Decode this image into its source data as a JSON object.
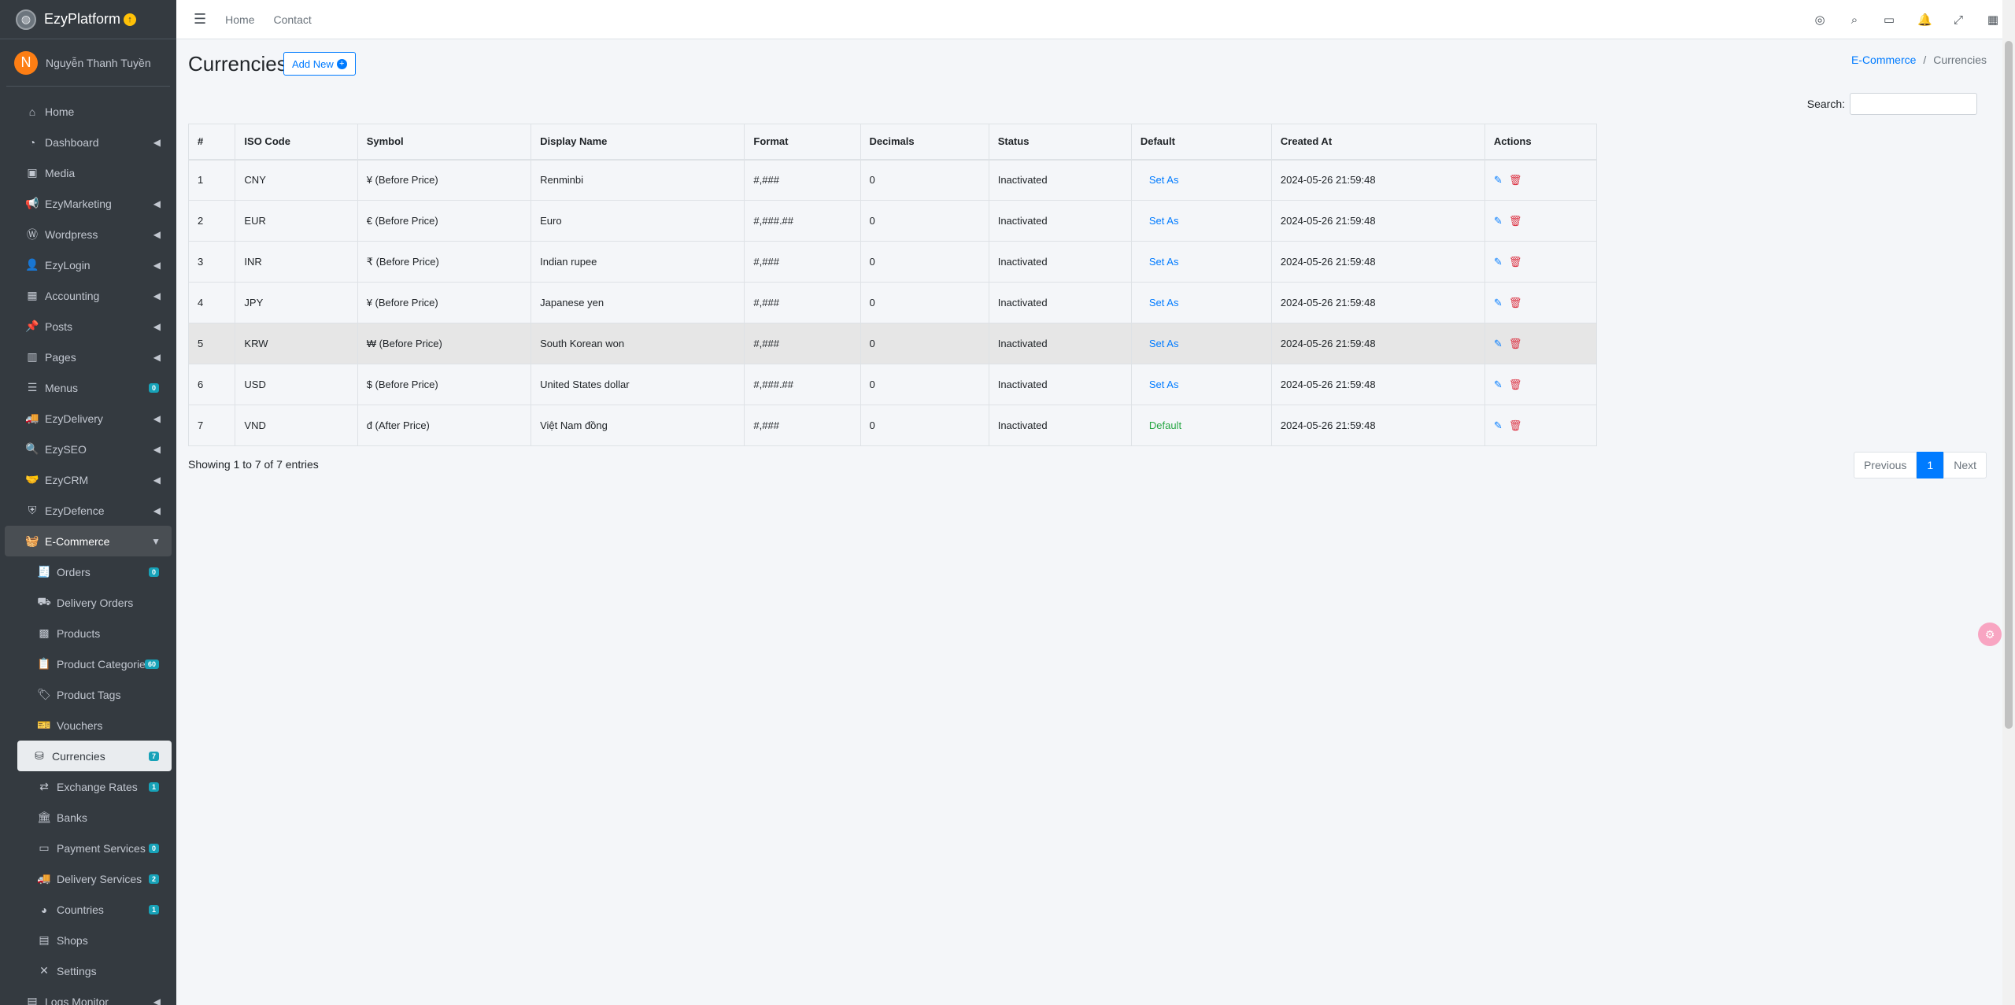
{
  "brand": {
    "name": "EzyPlatform"
  },
  "user": {
    "initial": "N",
    "name": "Nguyễn Thanh Tuyền"
  },
  "sidebar": {
    "items": [
      {
        "label": "Home",
        "icon": "home-icon",
        "arrow": false,
        "badge": null
      },
      {
        "label": "Dashboard",
        "icon": "dashboard-icon",
        "arrow": true,
        "badge": null
      },
      {
        "label": "Media",
        "icon": "image-icon",
        "arrow": false,
        "badge": null
      },
      {
        "label": "EzyMarketing",
        "icon": "megaphone-icon",
        "arrow": true,
        "badge": null
      },
      {
        "label": "Wordpress",
        "icon": "wordpress-icon",
        "arrow": true,
        "badge": null
      },
      {
        "label": "EzyLogin",
        "icon": "user-login-icon",
        "arrow": true,
        "badge": null
      },
      {
        "label": "Accounting",
        "icon": "calculator-icon",
        "arrow": true,
        "badge": null
      },
      {
        "label": "Posts",
        "icon": "pin-icon",
        "arrow": true,
        "badge": null
      },
      {
        "label": "Pages",
        "icon": "columns-icon",
        "arrow": true,
        "badge": null
      },
      {
        "label": "Menus",
        "icon": "menu-icon",
        "arrow": false,
        "badge": "0"
      },
      {
        "label": "EzyDelivery",
        "icon": "truck-icon",
        "arrow": true,
        "badge": null
      },
      {
        "label": "EzySEO",
        "icon": "seo-search-icon",
        "arrow": true,
        "badge": null
      },
      {
        "label": "EzyCRM",
        "icon": "handshake-icon",
        "arrow": true,
        "badge": null
      },
      {
        "label": "EzyDefence",
        "icon": "shield-icon",
        "arrow": true,
        "badge": null
      },
      {
        "label": "E-Commerce",
        "icon": "basket-icon",
        "arrow": true,
        "badge": null
      }
    ],
    "ecommerce_items": [
      {
        "label": "Orders",
        "icon": "receipt-icon",
        "badge": "0"
      },
      {
        "label": "Delivery Orders",
        "icon": "dolly-icon",
        "badge": null
      },
      {
        "label": "Products",
        "icon": "boxes-icon",
        "badge": null
      },
      {
        "label": "Product Categories",
        "icon": "clipboard-list-icon",
        "badge": "60"
      },
      {
        "label": "Product Tags",
        "icon": "tags-icon",
        "badge": null
      },
      {
        "label": "Vouchers",
        "icon": "ticket-icon",
        "badge": null
      },
      {
        "label": "Currencies",
        "icon": "coins-icon",
        "badge": "7"
      },
      {
        "label": "Exchange Rates",
        "icon": "exchange-icon",
        "badge": "1"
      },
      {
        "label": "Banks",
        "icon": "bank-icon",
        "badge": null
      },
      {
        "label": "Payment Services",
        "icon": "wallet-icon",
        "badge": "0"
      },
      {
        "label": "Delivery Services",
        "icon": "truck-icon",
        "badge": "2"
      },
      {
        "label": "Countries",
        "icon": "globe-icon",
        "badge": "1"
      },
      {
        "label": "Shops",
        "icon": "store-icon",
        "badge": null
      },
      {
        "label": "Settings",
        "icon": "tools-icon",
        "badge": null
      }
    ],
    "logs_monitor": "Logs Monitor"
  },
  "topbar": {
    "home": "Home",
    "contact": "Contact"
  },
  "page": {
    "title": "Currencies",
    "add_new": "Add New",
    "breadcrumb_parent": "E-Commerce",
    "breadcrumb_current": "Currencies",
    "search_label": "Search:",
    "search_value": ""
  },
  "table": {
    "columns": [
      "#",
      "ISO Code",
      "Symbol",
      "Display Name",
      "Format",
      "Decimals",
      "Status",
      "Default",
      "Created At",
      "Actions"
    ],
    "rows": [
      {
        "num": "1",
        "iso": "CNY",
        "symbol": "¥ (Before Price)",
        "display": "Renminbi",
        "format": "#,###",
        "decimals": "0",
        "status": "Inactivated",
        "default": "Set As",
        "created": "2024-05-26 21:59:48"
      },
      {
        "num": "2",
        "iso": "EUR",
        "symbol": "€ (Before Price)",
        "display": "Euro",
        "format": "#,###.##",
        "decimals": "0",
        "status": "Inactivated",
        "default": "Set As",
        "created": "2024-05-26 21:59:48"
      },
      {
        "num": "3",
        "iso": "INR",
        "symbol": "₹ (Before Price)",
        "display": "Indian rupee",
        "format": "#,###",
        "decimals": "0",
        "status": "Inactivated",
        "default": "Set As",
        "created": "2024-05-26 21:59:48"
      },
      {
        "num": "4",
        "iso": "JPY",
        "symbol": "¥ (Before Price)",
        "display": "Japanese yen",
        "format": "#,###",
        "decimals": "0",
        "status": "Inactivated",
        "default": "Set As",
        "created": "2024-05-26 21:59:48"
      },
      {
        "num": "5",
        "iso": "KRW",
        "symbol": "₩ (Before Price)",
        "display": "South Korean won",
        "format": "#,###",
        "decimals": "0",
        "status": "Inactivated",
        "default": "Set As",
        "created": "2024-05-26 21:59:48"
      },
      {
        "num": "6",
        "iso": "USD",
        "symbol": "$ (Before Price)",
        "display": "United States dollar",
        "format": "#,###.##",
        "decimals": "0",
        "status": "Inactivated",
        "default": "Set As",
        "created": "2024-05-26 21:59:48"
      },
      {
        "num": "7",
        "iso": "VND",
        "symbol": "đ (After Price)",
        "display": "Việt Nam đồng",
        "format": "#,###",
        "decimals": "0",
        "status": "Inactivated",
        "default": "Default",
        "created": "2024-05-26 21:59:48"
      }
    ]
  },
  "footer": {
    "info": "Showing 1 to 7 of 7 entries",
    "previous": "Previous",
    "page": "1",
    "next": "Next"
  },
  "colors": {
    "sidebar_bg": "#343a40",
    "accent": "#007bff",
    "danger": "#dc3545",
    "success": "#28a745",
    "badge": "#17a2b8"
  }
}
